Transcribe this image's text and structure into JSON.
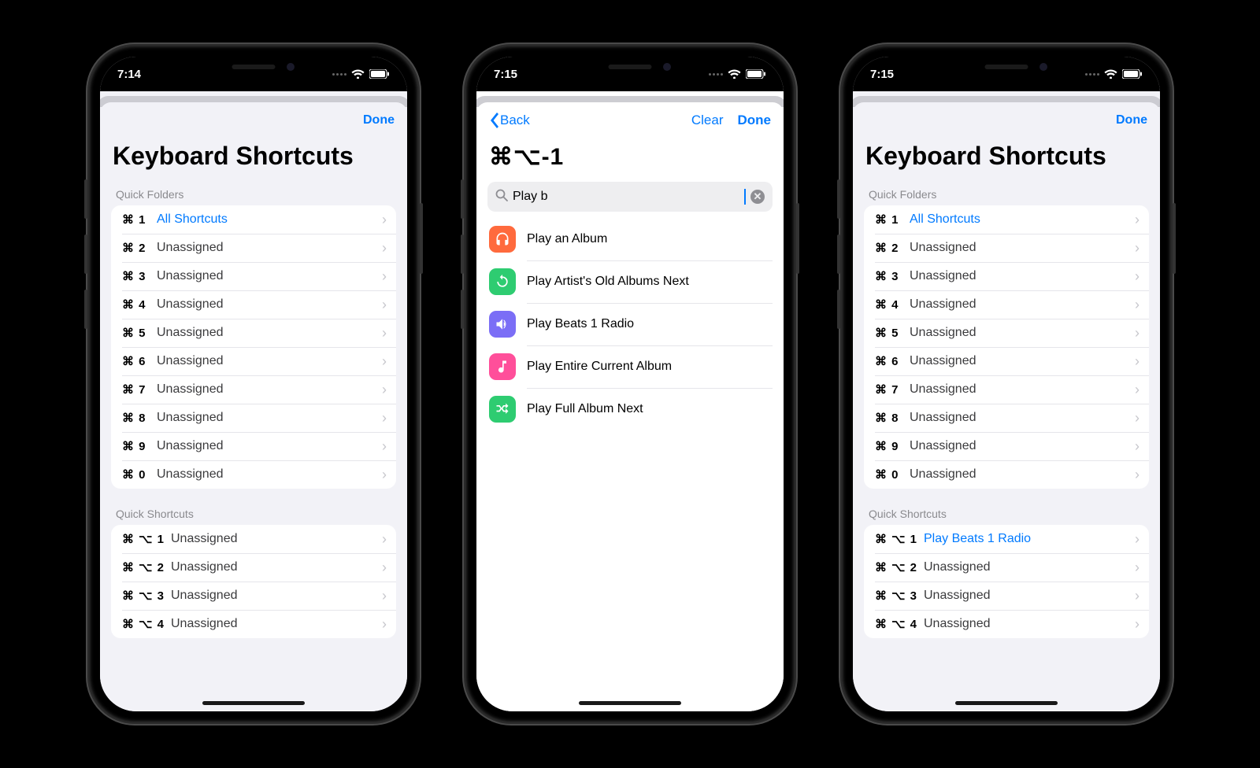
{
  "phone1": {
    "time": "7:14",
    "done": "Done",
    "title": "Keyboard Shortcuts",
    "section1": "Quick Folders",
    "section2": "Quick Shortcuts",
    "folders": [
      {
        "key": "⌘ 1",
        "label": "All Shortcuts",
        "assigned": true
      },
      {
        "key": "⌘ 2",
        "label": "Unassigned"
      },
      {
        "key": "⌘ 3",
        "label": "Unassigned"
      },
      {
        "key": "⌘ 4",
        "label": "Unassigned"
      },
      {
        "key": "⌘ 5",
        "label": "Unassigned"
      },
      {
        "key": "⌘ 6",
        "label": "Unassigned"
      },
      {
        "key": "⌘ 7",
        "label": "Unassigned"
      },
      {
        "key": "⌘ 8",
        "label": "Unassigned"
      },
      {
        "key": "⌘ 9",
        "label": "Unassigned"
      },
      {
        "key": "⌘ 0",
        "label": "Unassigned"
      }
    ],
    "shortcuts": [
      {
        "key": "⌘ ⌥ 1",
        "label": "Unassigned"
      },
      {
        "key": "⌘ ⌥ 2",
        "label": "Unassigned"
      },
      {
        "key": "⌘ ⌥ 3",
        "label": "Unassigned"
      },
      {
        "key": "⌘ ⌥ 4",
        "label": "Unassigned"
      }
    ]
  },
  "phone2": {
    "time": "7:15",
    "back": "Back",
    "clear": "Clear",
    "done": "Done",
    "combo": "⌘⌥-1",
    "search_value": "Play b",
    "results": [
      {
        "label": "Play an Album",
        "color": "#ff6a3d",
        "glyph": "headphones"
      },
      {
        "label": "Play Artist's Old Albums Next",
        "color": "#2ecc71",
        "glyph": "sync"
      },
      {
        "label": "Play Beats 1 Radio",
        "color": "#7b6ef6",
        "glyph": "speaker"
      },
      {
        "label": "Play Entire Current Album",
        "color": "#ff4f9a",
        "glyph": "music"
      },
      {
        "label": "Play Full Album Next",
        "color": "#2ecc71",
        "glyph": "shuffle"
      }
    ]
  },
  "phone3": {
    "time": "7:15",
    "done": "Done",
    "title": "Keyboard Shortcuts",
    "section1": "Quick Folders",
    "section2": "Quick Shortcuts",
    "folders": [
      {
        "key": "⌘ 1",
        "label": "All Shortcuts",
        "assigned": true
      },
      {
        "key": "⌘ 2",
        "label": "Unassigned"
      },
      {
        "key": "⌘ 3",
        "label": "Unassigned"
      },
      {
        "key": "⌘ 4",
        "label": "Unassigned"
      },
      {
        "key": "⌘ 5",
        "label": "Unassigned"
      },
      {
        "key": "⌘ 6",
        "label": "Unassigned"
      },
      {
        "key": "⌘ 7",
        "label": "Unassigned"
      },
      {
        "key": "⌘ 8",
        "label": "Unassigned"
      },
      {
        "key": "⌘ 9",
        "label": "Unassigned"
      },
      {
        "key": "⌘ 0",
        "label": "Unassigned"
      }
    ],
    "shortcuts": [
      {
        "key": "⌘ ⌥ 1",
        "label": "Play Beats 1 Radio",
        "assigned": true
      },
      {
        "key": "⌘ ⌥ 2",
        "label": "Unassigned"
      },
      {
        "key": "⌘ ⌥ 3",
        "label": "Unassigned"
      },
      {
        "key": "⌘ ⌥ 4",
        "label": "Unassigned"
      }
    ]
  },
  "colors": {
    "tint": "#007aff"
  }
}
